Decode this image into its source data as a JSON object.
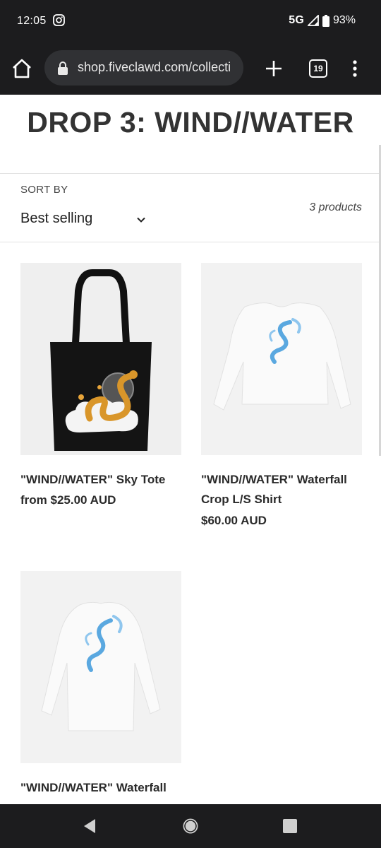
{
  "status_bar": {
    "time": "12:05",
    "network": "5G",
    "battery": "93%"
  },
  "browser": {
    "url": "shop.fiveclawd.com/collecti",
    "tab_count": "19"
  },
  "page": {
    "title": "DROP 3: WIND//WATER",
    "sort_label": "SORT BY",
    "sort_value": "Best selling",
    "product_count": "3 products"
  },
  "products": [
    {
      "title": "\"WIND//WATER\" Sky Tote",
      "price": "from $25.00 AUD"
    },
    {
      "title": "\"WIND//WATER\" Waterfall Crop L/S Shirt",
      "price": "$60.00 AUD"
    },
    {
      "title": "\"WIND//WATER\" Waterfall",
      "price": ""
    }
  ],
  "colors": {
    "chrome_bg": "#1c1c1e",
    "url_bar_bg": "#303134",
    "dragon_gold": "#d9962a",
    "dragon_blue": "#5aa8e0"
  }
}
